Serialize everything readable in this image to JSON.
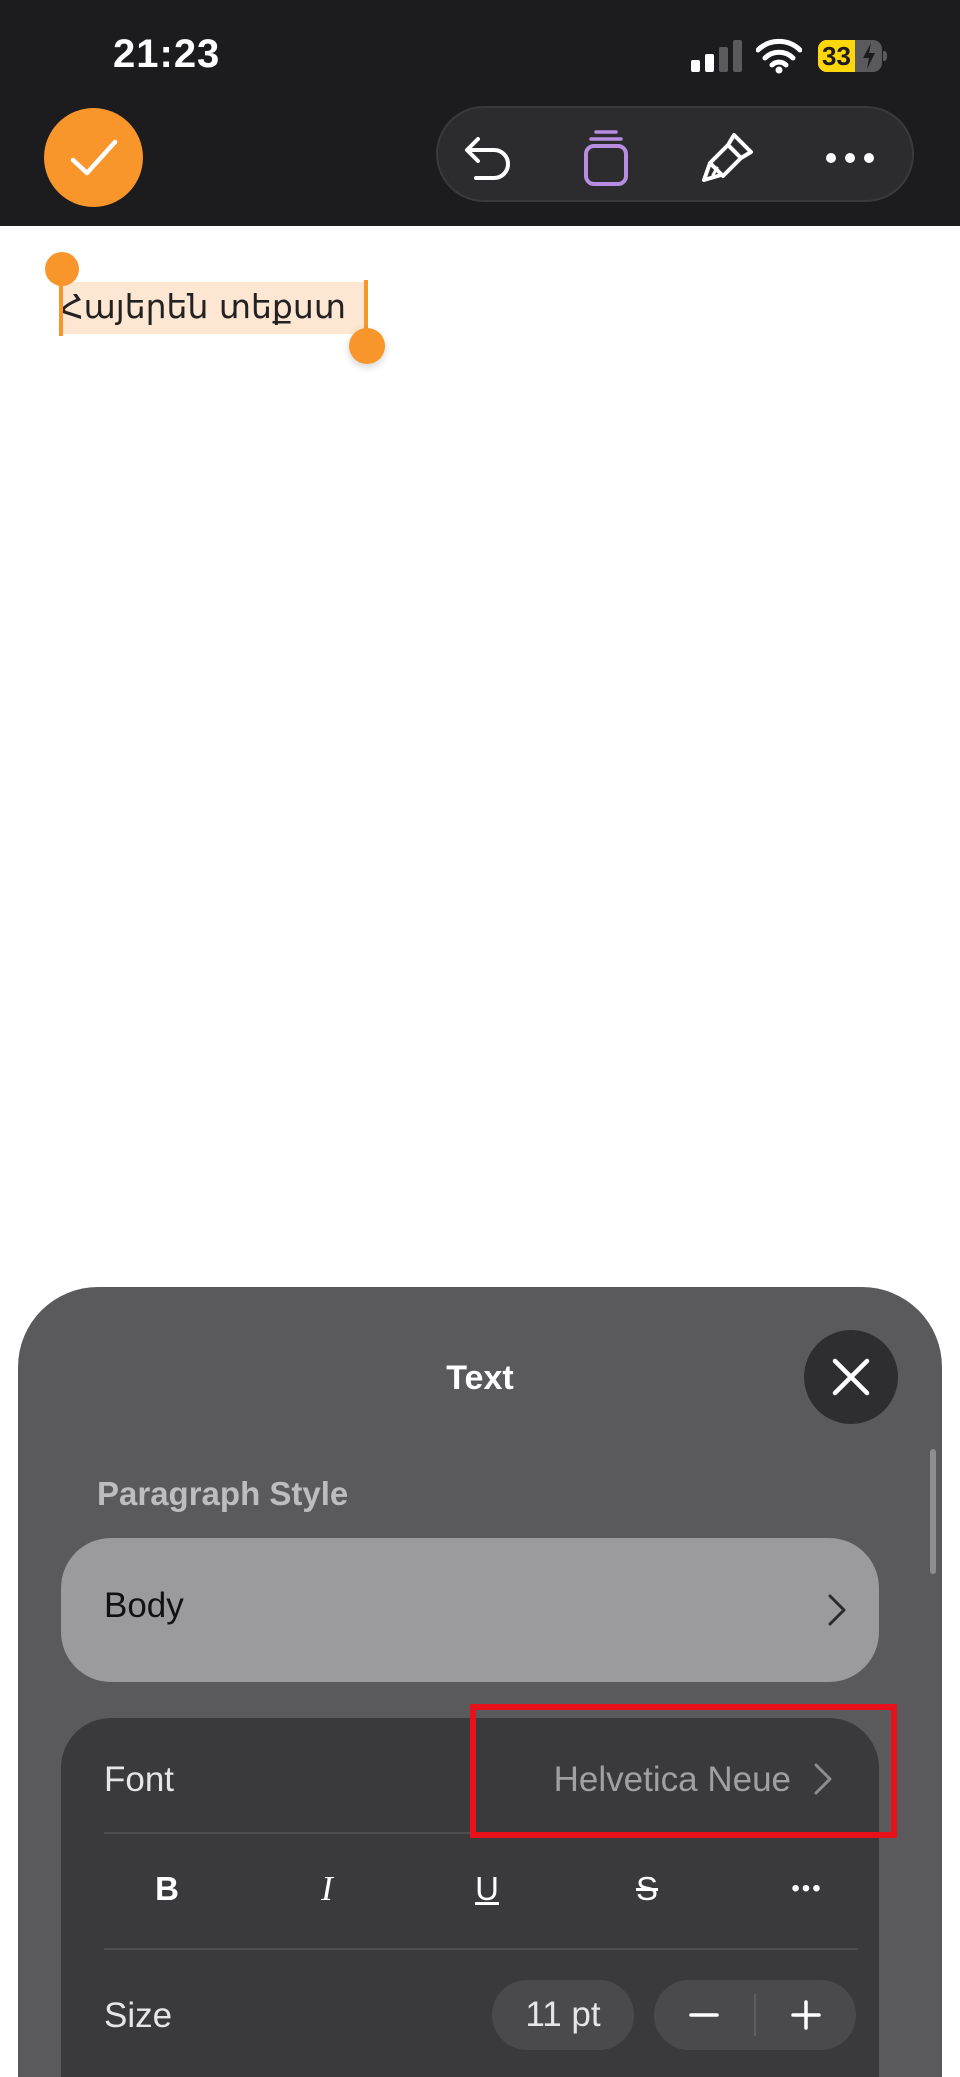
{
  "status_bar": {
    "time": "21:23",
    "battery_level": "33"
  },
  "toolbar": {
    "done_icon": "checkmark-icon",
    "buttons": [
      "undo-icon",
      "insert-stack-icon",
      "paintbrush-icon",
      "more-icon"
    ]
  },
  "document": {
    "selected_text": "Հայերեն տեքստ"
  },
  "text_panel": {
    "title": "Text",
    "paragraph_style_label": "Paragraph Style",
    "paragraph_style_value": "Body",
    "font_label": "Font",
    "font_value": "Helvetica Neue",
    "format_buttons": {
      "bold": "B",
      "italic": "I",
      "underline": "U",
      "strikethrough": "S",
      "more": "•••"
    },
    "size_label": "Size",
    "size_value": "11 pt"
  },
  "colors": {
    "accent": "#f8952b",
    "highlight_annotation": "#e8111b",
    "panel_background": "#5a5a5c"
  }
}
